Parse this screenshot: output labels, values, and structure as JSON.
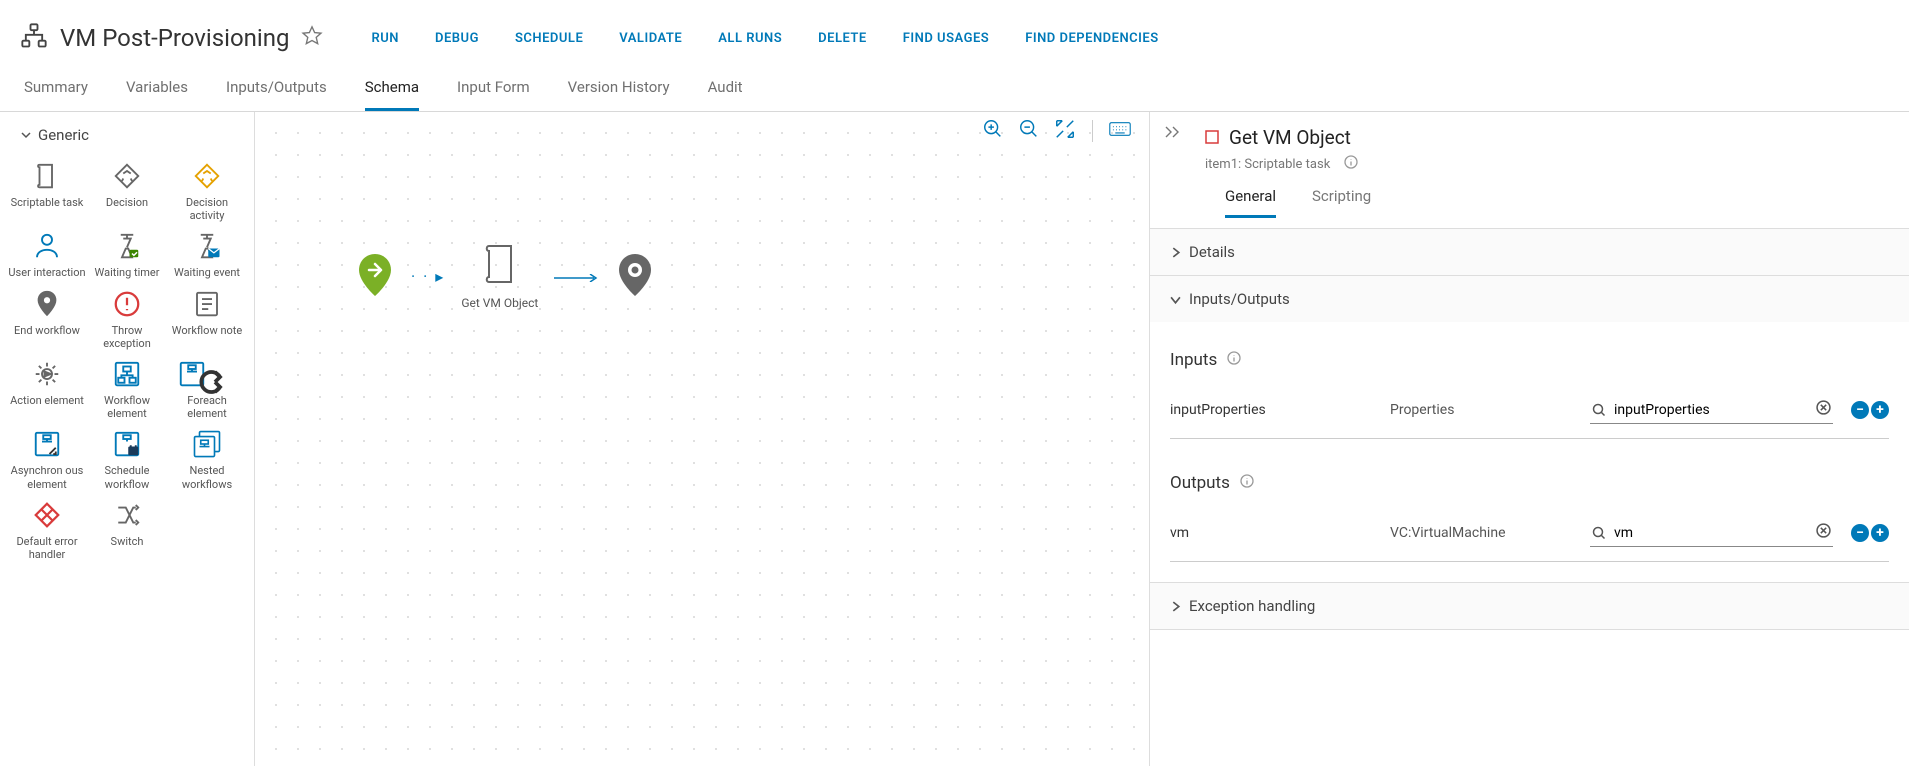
{
  "title": "VM Post-Provisioning",
  "actions": [
    "RUN",
    "DEBUG",
    "SCHEDULE",
    "VALIDATE",
    "ALL RUNS",
    "DELETE",
    "FIND USAGES",
    "FIND DEPENDENCIES"
  ],
  "tabs": [
    "Summary",
    "Variables",
    "Inputs/Outputs",
    "Schema",
    "Input Form",
    "Version History",
    "Audit"
  ],
  "active_tab": "Schema",
  "palette": {
    "group": "Generic",
    "items": [
      "Scriptable task",
      "Decision",
      "Decision activity",
      "User interaction",
      "Waiting timer",
      "Waiting event",
      "End workflow",
      "Throw exception",
      "Workflow note",
      "Action element",
      "Workflow element",
      "Foreach element",
      "Asynchron ous element",
      "Schedule workflow",
      "Nested workflows",
      "Default error handler",
      "Switch"
    ]
  },
  "canvas": {
    "node_label": "Get VM Object"
  },
  "inspector": {
    "title": "Get VM Object",
    "subtitle": "item1: Scriptable task",
    "tabs": [
      "General",
      "Scripting"
    ],
    "active_tab": "General",
    "sections": {
      "details": "Details",
      "io": "Inputs/Outputs",
      "exception": "Exception handling"
    },
    "inputs_label": "Inputs",
    "outputs_label": "Outputs",
    "inputs": [
      {
        "name": "inputProperties",
        "type": "Properties",
        "value": "inputProperties"
      }
    ],
    "outputs": [
      {
        "name": "vm",
        "type": "VC:VirtualMachine",
        "value": "vm"
      }
    ]
  }
}
